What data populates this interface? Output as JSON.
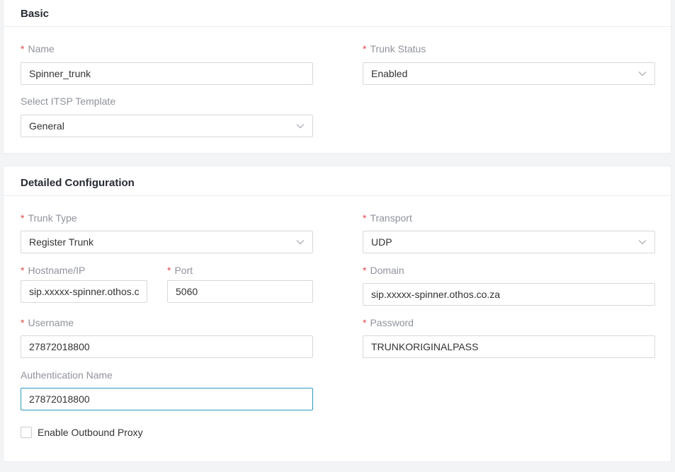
{
  "basic": {
    "title": "Basic",
    "name": {
      "label": "Name",
      "value": "Spinner_trunk"
    },
    "trunk_status": {
      "label": "Trunk Status",
      "value": "Enabled"
    },
    "itsp_template": {
      "label": "Select ITSP Template",
      "value": "General"
    }
  },
  "detailed": {
    "title": "Detailed Configuration",
    "trunk_type": {
      "label": "Trunk Type",
      "value": "Register Trunk"
    },
    "transport": {
      "label": "Transport",
      "value": "UDP"
    },
    "hostname": {
      "label": "Hostname/IP",
      "value": "sip.xxxxx-spinner.othos.co.za"
    },
    "port": {
      "label": "Port",
      "value": "5060"
    },
    "domain": {
      "label": "Domain",
      "value": "sip.xxxxx-spinner.othos.co.za"
    },
    "username": {
      "label": "Username",
      "value": "27872018800"
    },
    "password": {
      "label": "Password",
      "value": "TRUNKORIGINALPASS"
    },
    "auth_name": {
      "label": "Authentication Name",
      "value": "27872018800"
    },
    "outbound_proxy": {
      "label": "Enable Outbound Proxy",
      "checked": false
    }
  },
  "colors": {
    "required": "#e84749",
    "focus_border": "#2c9abf",
    "label": "#8f939c"
  }
}
